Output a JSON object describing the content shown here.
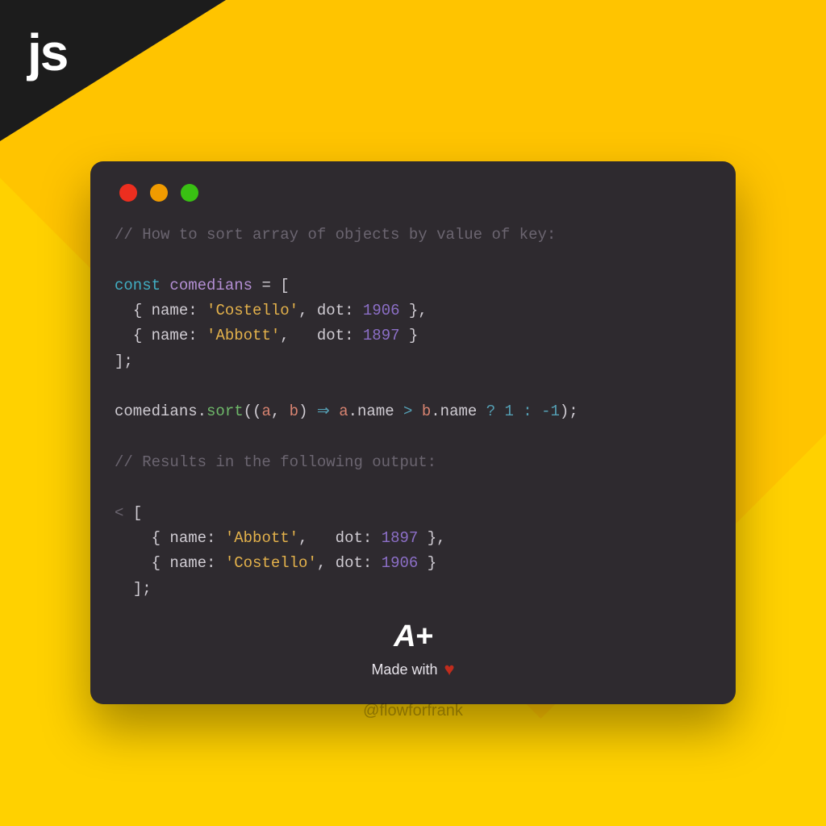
{
  "corner_label": "js",
  "code": {
    "comment1": "// How to sort array of objects by value of key:",
    "kw_const": "const",
    "var_name": "comedians",
    "obj1_name_key": "name",
    "obj1_name_val": "'Costello'",
    "obj1_dot_key": "dot",
    "obj1_dot_val": "1906",
    "obj2_name_key": "name",
    "obj2_name_val": "'Abbott'",
    "obj2_dot_key": "dot",
    "obj2_dot_val": "1897",
    "call_obj": "comedians",
    "call_fn": "sort",
    "param_a": "a",
    "param_b": "b",
    "arrow": "⇒",
    "acc_a": "a",
    "acc_name1": "name",
    "gt": ">",
    "acc_b": "b",
    "acc_name2": "name",
    "ternary": "? 1 : -1",
    "comment2": "// Results in the following output:",
    "out_prompt": "<",
    "out1_name_key": "name",
    "out1_name_val": "'Abbott'",
    "out1_dot_key": "dot",
    "out1_dot_val": "1897",
    "out2_name_key": "name",
    "out2_name_val": "'Costello'",
    "out2_dot_key": "dot",
    "out2_dot_val": "1906"
  },
  "brand": {
    "logo": "A+",
    "made_with": "Made with"
  },
  "handle": "@flowforfrank"
}
